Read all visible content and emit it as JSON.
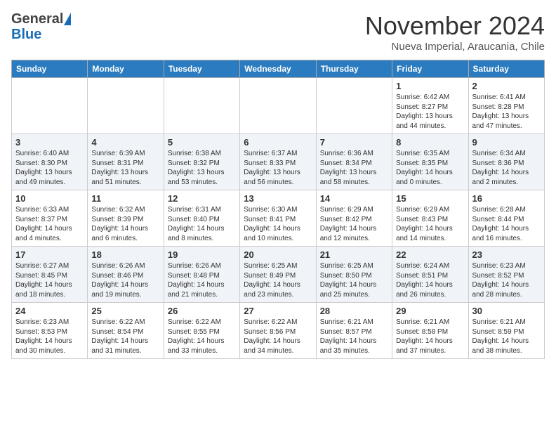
{
  "header": {
    "logo_general": "General",
    "logo_blue": "Blue",
    "month_title": "November 2024",
    "location": "Nueva Imperial, Araucania, Chile"
  },
  "days_of_week": [
    "Sunday",
    "Monday",
    "Tuesday",
    "Wednesday",
    "Thursday",
    "Friday",
    "Saturday"
  ],
  "weeks": [
    {
      "shaded": false,
      "days": [
        {
          "date": "",
          "info": ""
        },
        {
          "date": "",
          "info": ""
        },
        {
          "date": "",
          "info": ""
        },
        {
          "date": "",
          "info": ""
        },
        {
          "date": "",
          "info": ""
        },
        {
          "date": "1",
          "info": "Sunrise: 6:42 AM\nSunset: 8:27 PM\nDaylight: 13 hours\nand 44 minutes."
        },
        {
          "date": "2",
          "info": "Sunrise: 6:41 AM\nSunset: 8:28 PM\nDaylight: 13 hours\nand 47 minutes."
        }
      ]
    },
    {
      "shaded": true,
      "days": [
        {
          "date": "3",
          "info": "Sunrise: 6:40 AM\nSunset: 8:30 PM\nDaylight: 13 hours\nand 49 minutes."
        },
        {
          "date": "4",
          "info": "Sunrise: 6:39 AM\nSunset: 8:31 PM\nDaylight: 13 hours\nand 51 minutes."
        },
        {
          "date": "5",
          "info": "Sunrise: 6:38 AM\nSunset: 8:32 PM\nDaylight: 13 hours\nand 53 minutes."
        },
        {
          "date": "6",
          "info": "Sunrise: 6:37 AM\nSunset: 8:33 PM\nDaylight: 13 hours\nand 56 minutes."
        },
        {
          "date": "7",
          "info": "Sunrise: 6:36 AM\nSunset: 8:34 PM\nDaylight: 13 hours\nand 58 minutes."
        },
        {
          "date": "8",
          "info": "Sunrise: 6:35 AM\nSunset: 8:35 PM\nDaylight: 14 hours\nand 0 minutes."
        },
        {
          "date": "9",
          "info": "Sunrise: 6:34 AM\nSunset: 8:36 PM\nDaylight: 14 hours\nand 2 minutes."
        }
      ]
    },
    {
      "shaded": false,
      "days": [
        {
          "date": "10",
          "info": "Sunrise: 6:33 AM\nSunset: 8:37 PM\nDaylight: 14 hours\nand 4 minutes."
        },
        {
          "date": "11",
          "info": "Sunrise: 6:32 AM\nSunset: 8:39 PM\nDaylight: 14 hours\nand 6 minutes."
        },
        {
          "date": "12",
          "info": "Sunrise: 6:31 AM\nSunset: 8:40 PM\nDaylight: 14 hours\nand 8 minutes."
        },
        {
          "date": "13",
          "info": "Sunrise: 6:30 AM\nSunset: 8:41 PM\nDaylight: 14 hours\nand 10 minutes."
        },
        {
          "date": "14",
          "info": "Sunrise: 6:29 AM\nSunset: 8:42 PM\nDaylight: 14 hours\nand 12 minutes."
        },
        {
          "date": "15",
          "info": "Sunrise: 6:29 AM\nSunset: 8:43 PM\nDaylight: 14 hours\nand 14 minutes."
        },
        {
          "date": "16",
          "info": "Sunrise: 6:28 AM\nSunset: 8:44 PM\nDaylight: 14 hours\nand 16 minutes."
        }
      ]
    },
    {
      "shaded": true,
      "days": [
        {
          "date": "17",
          "info": "Sunrise: 6:27 AM\nSunset: 8:45 PM\nDaylight: 14 hours\nand 18 minutes."
        },
        {
          "date": "18",
          "info": "Sunrise: 6:26 AM\nSunset: 8:46 PM\nDaylight: 14 hours\nand 19 minutes."
        },
        {
          "date": "19",
          "info": "Sunrise: 6:26 AM\nSunset: 8:48 PM\nDaylight: 14 hours\nand 21 minutes."
        },
        {
          "date": "20",
          "info": "Sunrise: 6:25 AM\nSunset: 8:49 PM\nDaylight: 14 hours\nand 23 minutes."
        },
        {
          "date": "21",
          "info": "Sunrise: 6:25 AM\nSunset: 8:50 PM\nDaylight: 14 hours\nand 25 minutes."
        },
        {
          "date": "22",
          "info": "Sunrise: 6:24 AM\nSunset: 8:51 PM\nDaylight: 14 hours\nand 26 minutes."
        },
        {
          "date": "23",
          "info": "Sunrise: 6:23 AM\nSunset: 8:52 PM\nDaylight: 14 hours\nand 28 minutes."
        }
      ]
    },
    {
      "shaded": false,
      "days": [
        {
          "date": "24",
          "info": "Sunrise: 6:23 AM\nSunset: 8:53 PM\nDaylight: 14 hours\nand 30 minutes."
        },
        {
          "date": "25",
          "info": "Sunrise: 6:22 AM\nSunset: 8:54 PM\nDaylight: 14 hours\nand 31 minutes."
        },
        {
          "date": "26",
          "info": "Sunrise: 6:22 AM\nSunset: 8:55 PM\nDaylight: 14 hours\nand 33 minutes."
        },
        {
          "date": "27",
          "info": "Sunrise: 6:22 AM\nSunset: 8:56 PM\nDaylight: 14 hours\nand 34 minutes."
        },
        {
          "date": "28",
          "info": "Sunrise: 6:21 AM\nSunset: 8:57 PM\nDaylight: 14 hours\nand 35 minutes."
        },
        {
          "date": "29",
          "info": "Sunrise: 6:21 AM\nSunset: 8:58 PM\nDaylight: 14 hours\nand 37 minutes."
        },
        {
          "date": "30",
          "info": "Sunrise: 6:21 AM\nSunset: 8:59 PM\nDaylight: 14 hours\nand 38 minutes."
        }
      ]
    }
  ]
}
